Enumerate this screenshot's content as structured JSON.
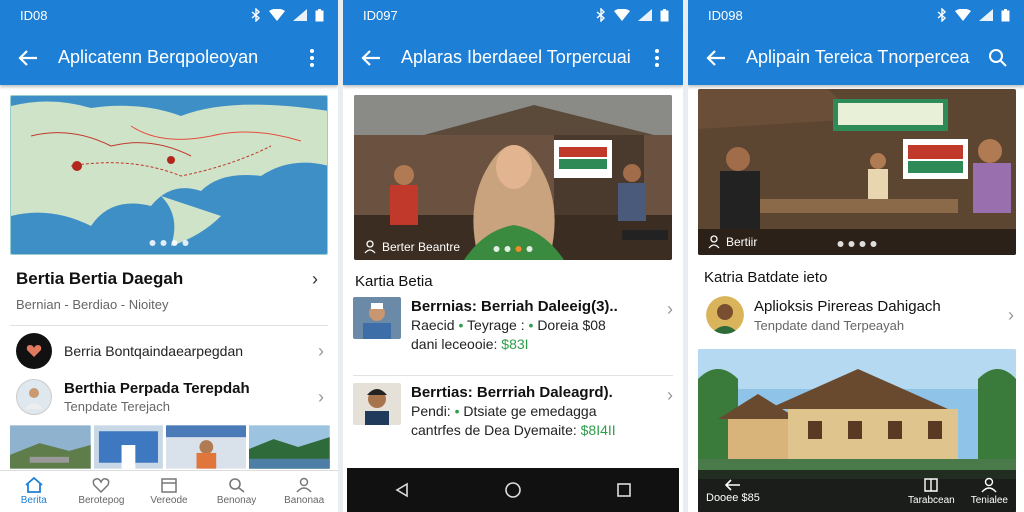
{
  "phone1": {
    "status_time": "ID08",
    "title": "Aplicatenn Berqpoleoyan",
    "carousel_dots": 4,
    "row1_title": "Bertia Bertia Daegah",
    "row1_sub": "Bernian - Berdiao  -  Nioitey",
    "item1_text": "Berria Bontqaindaearpegdan",
    "item2_title": "Berthia Perpada Terepdah",
    "item2_sub": "Tenpdate Terejach",
    "nav": [
      "Berita",
      "Berotepog",
      "Vereode",
      "Benonay",
      "Banonaa"
    ]
  },
  "phone2": {
    "status_time": "ID097",
    "title": "Aplaras Iberdaeel Torpercuai",
    "hero_caption": "Berter Beantre",
    "section_title": "Kartia Betia",
    "item1_title": "Berrnias: Berriah Daleeig(3)..",
    "item1_line2_a": "Raecid",
    "item1_line2_b": "Teyrage :",
    "item1_line2_c": "Doreia",
    "item1_line2_d": "$08",
    "item1_line3_a": "dani leceooie:",
    "item1_line3_b": "$83I",
    "item2_title": "Berrtias: Berrriah Daleagrd).",
    "item2_line2_a": "Pendi:",
    "item2_line2_b": "Dtsiate",
    "item2_line2_c": "ge emedagga",
    "item2_line3_a": "cantrfes de Dea Dyemaite:",
    "item2_line3_b": "$8I4II"
  },
  "phone3": {
    "status_time": "ID098",
    "title": "Aplipain Tereica Tnorpercea",
    "hero_caption": "Bertiir",
    "section_title": "Katria Batdate ieto",
    "item_title": "Aplioksis Pirereas Dahigach",
    "item_sub": "Tenpdate dand Terpeayah",
    "bottom_caption": "Dooee",
    "bottom_caption_b": "$85",
    "nav": [
      "Tarabcean",
      "Tenialee"
    ]
  },
  "colors": {
    "primary": "#1e7fd6",
    "accent": "#f08a2b",
    "link_green": "#2e9d4a"
  }
}
